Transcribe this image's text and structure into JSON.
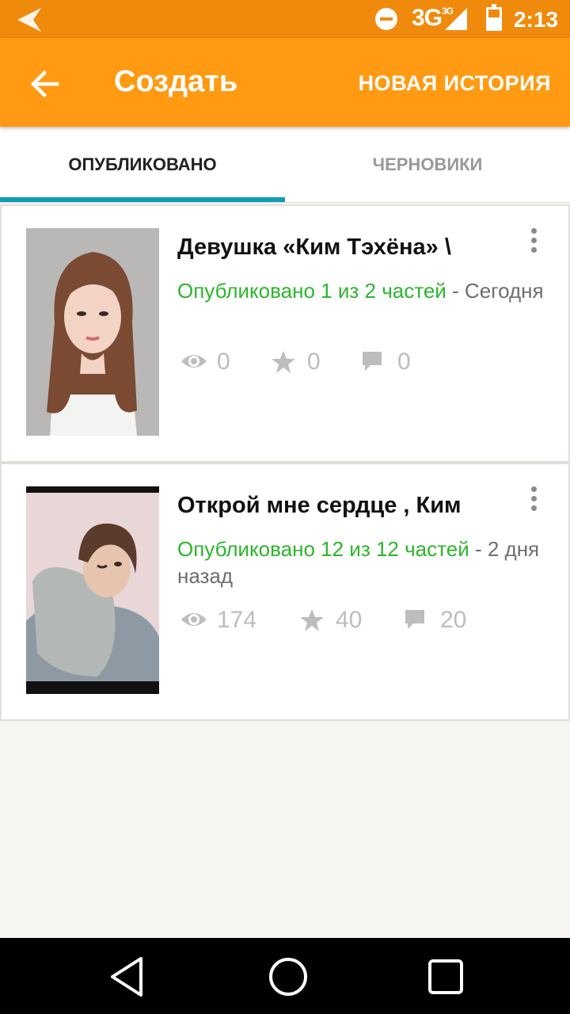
{
  "status_bar": {
    "network": "3G",
    "network_sup": "3G",
    "time": "2:13",
    "icons": [
      "app-notification-icon",
      "do-not-disturb-icon",
      "signal-icon",
      "battery-charging-icon"
    ]
  },
  "appbar": {
    "title": "Создать",
    "action": "НОВАЯ ИСТОРИЯ",
    "color": "#ff9a12"
  },
  "tabs": [
    {
      "label": "ОПУБЛИКОВАНО",
      "selected": true
    },
    {
      "label": "ЧЕРНОВИКИ",
      "selected": false
    }
  ],
  "stories": [
    {
      "title": "Девушка «Ким Тэхёна» \\",
      "published": "Опубликовано 1 из 2 частей",
      "separator": " - ",
      "date": "Сегодня",
      "views": "0",
      "votes": "0",
      "comments": "0"
    },
    {
      "title": "Открой мне сердце , Ким",
      "published": "Опубликовано 12 из 12 частей",
      "separator": " - ",
      "date": "2 дня назад",
      "views": "174",
      "votes": "40",
      "comments": "20"
    }
  ],
  "nav": {
    "icons": [
      "back-triangle-icon",
      "home-circle-icon",
      "recents-square-icon"
    ]
  },
  "colors": {
    "published": "#2db52d",
    "tab_indicator": "#0f9cb8",
    "status_bar": "#f08a0c"
  }
}
